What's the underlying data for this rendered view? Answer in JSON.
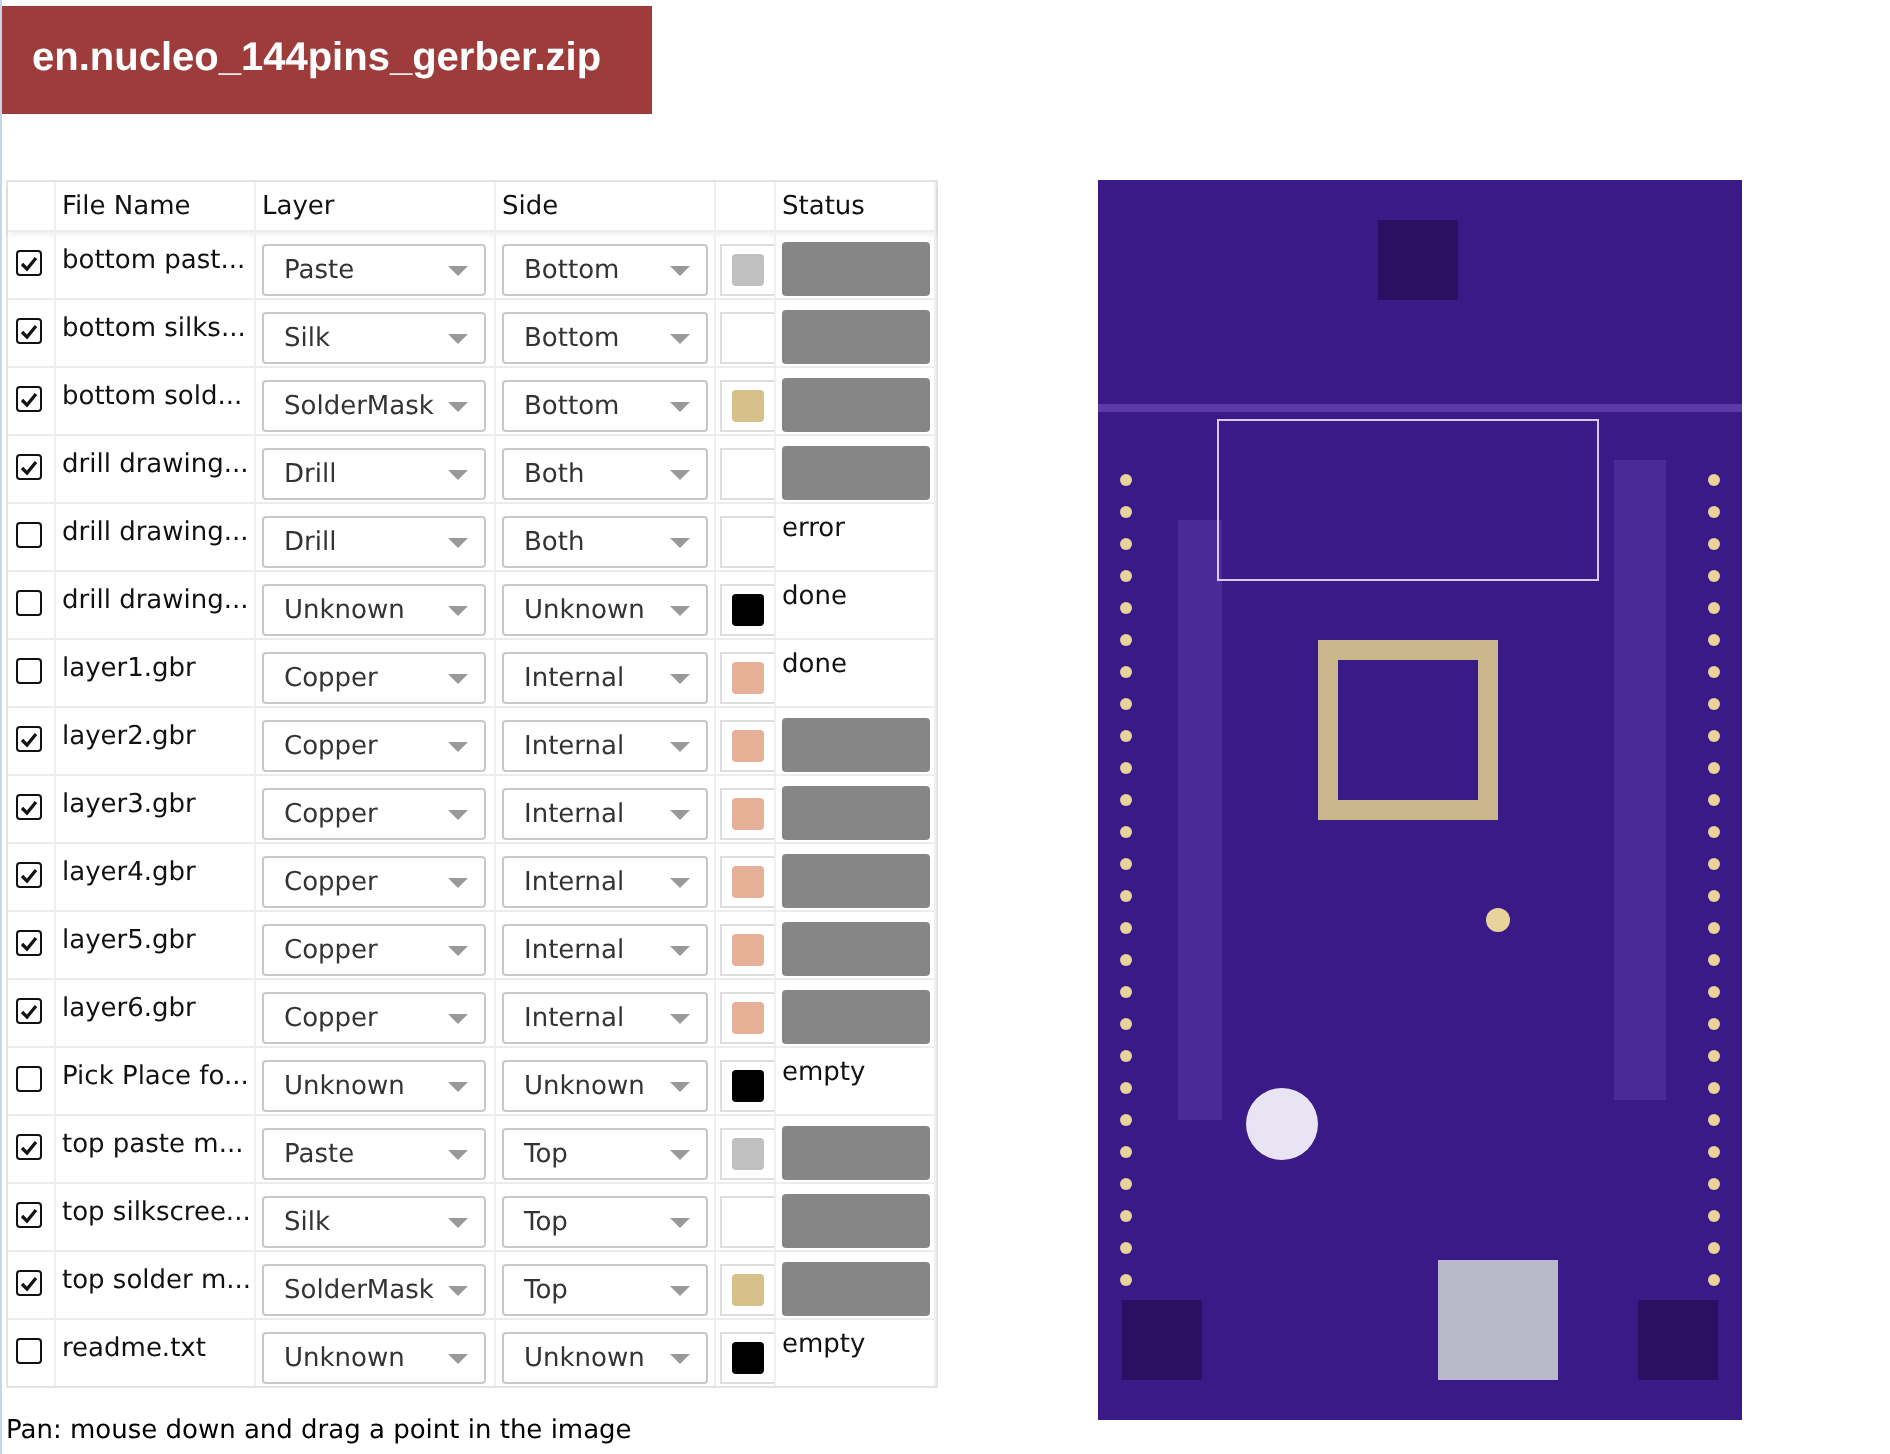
{
  "title": "en.nucleo_144pins_gerber.zip",
  "table": {
    "columns": [
      "File Name",
      "Layer",
      "Side",
      "Status"
    ],
    "rows": [
      {
        "checked": true,
        "name": "bottom past...",
        "layer": "Paste",
        "side": "Bottom",
        "color": "#c0c0c0",
        "kind": "pending"
      },
      {
        "checked": true,
        "name": "bottom silks...",
        "layer": "Silk",
        "side": "Bottom",
        "color": "#ffffff",
        "kind": "pending"
      },
      {
        "checked": true,
        "name": "bottom sold...",
        "layer": "SolderMask",
        "side": "Bottom",
        "color": "#d8c08a",
        "kind": "pending"
      },
      {
        "checked": true,
        "name": "drill drawing...",
        "layer": "Drill",
        "side": "Both",
        "color": "#ffffff",
        "kind": "pending"
      },
      {
        "checked": false,
        "name": "drill drawing...",
        "layer": "Drill",
        "side": "Both",
        "color": "#ffffff",
        "kind": "text",
        "status": "error"
      },
      {
        "checked": false,
        "name": "drill drawing...",
        "layer": "Unknown",
        "side": "Unknown",
        "color": "#000000",
        "kind": "text",
        "status": "done"
      },
      {
        "checked": false,
        "name": "layer1.gbr",
        "layer": "Copper",
        "side": "Internal",
        "color": "#e6b196",
        "kind": "text",
        "status": "done"
      },
      {
        "checked": true,
        "name": "layer2.gbr",
        "layer": "Copper",
        "side": "Internal",
        "color": "#e6b196",
        "kind": "pending"
      },
      {
        "checked": true,
        "name": "layer3.gbr",
        "layer": "Copper",
        "side": "Internal",
        "color": "#e6b196",
        "kind": "pending"
      },
      {
        "checked": true,
        "name": "layer4.gbr",
        "layer": "Copper",
        "side": "Internal",
        "color": "#e6b196",
        "kind": "pending"
      },
      {
        "checked": true,
        "name": "layer5.gbr",
        "layer": "Copper",
        "side": "Internal",
        "color": "#e6b196",
        "kind": "pending"
      },
      {
        "checked": true,
        "name": "layer6.gbr",
        "layer": "Copper",
        "side": "Internal",
        "color": "#e6b196",
        "kind": "pending"
      },
      {
        "checked": false,
        "name": "Pick Place fo...",
        "layer": "Unknown",
        "side": "Unknown",
        "color": "#000000",
        "kind": "text",
        "status": "empty"
      },
      {
        "checked": true,
        "name": "top paste m...",
        "layer": "Paste",
        "side": "Top",
        "color": "#c0c0c0",
        "kind": "pending"
      },
      {
        "checked": true,
        "name": "top silkscree...",
        "layer": "Silk",
        "side": "Top",
        "color": "#ffffff",
        "kind": "pending"
      },
      {
        "checked": true,
        "name": "top solder m...",
        "layer": "SolderMask",
        "side": "Top",
        "color": "#d8c08a",
        "kind": "pending"
      },
      {
        "checked": false,
        "name": "readme.txt",
        "layer": "Unknown",
        "side": "Unknown",
        "color": "#000000",
        "kind": "text",
        "status": "empty"
      }
    ]
  },
  "hint": "Pan: mouse down and drag a point in the image"
}
